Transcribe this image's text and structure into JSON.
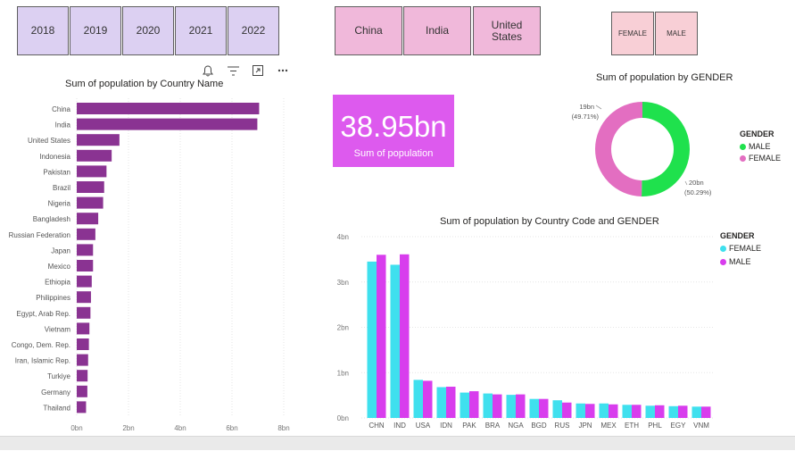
{
  "slicers": {
    "years": [
      "2018",
      "2019",
      "2020",
      "2021",
      "2022"
    ],
    "countries": [
      "China",
      "India",
      "United States"
    ],
    "genders": [
      "FEMALE",
      "MALE"
    ]
  },
  "colors": {
    "bar_purple": "#8a3392",
    "male_green": "#1fe14d",
    "female_pink": "#e36ec1",
    "female_cyan": "#3fe0ee",
    "male_magenta": "#d83ded",
    "card_bg": "#dd5aee"
  },
  "header_icons": [
    "bell-icon",
    "filter-icon",
    "focus-mode-icon",
    "more-options-icon"
  ],
  "card": {
    "value": "38.95bn",
    "label": "Sum of population"
  },
  "chart_data": [
    {
      "type": "bar",
      "orientation": "horizontal",
      "title": "Sum of population by Country Name",
      "categories": [
        "China",
        "India",
        "United States",
        "Indonesia",
        "Pakistan",
        "Brazil",
        "Nigeria",
        "Bangladesh",
        "Russian Federation",
        "Japan",
        "Mexico",
        "Ethiopia",
        "Philippines",
        "Egypt, Arab Rep.",
        "Vietnam",
        "Congo, Dem. Rep.",
        "Iran, Islamic Rep.",
        "Turkiye",
        "Germany",
        "Thailand"
      ],
      "values": [
        7.05,
        6.98,
        1.65,
        1.35,
        1.15,
        1.06,
        1.02,
        0.83,
        0.72,
        0.63,
        0.63,
        0.58,
        0.55,
        0.53,
        0.49,
        0.47,
        0.44,
        0.42,
        0.41,
        0.36
      ],
      "xticks": [
        "0bn",
        "2bn",
        "4bn",
        "6bn",
        "8bn"
      ],
      "xlim": [
        0,
        8
      ]
    },
    {
      "type": "pie",
      "donut": true,
      "title": "Sum of population by GENDER",
      "legend_title": "GENDER",
      "legend": [
        "MALE",
        "FEMALE"
      ],
      "slices": [
        {
          "name": "MALE",
          "value": 20,
          "percent": 50.29,
          "label_value": "20bn",
          "label_pct": "(50.29%)"
        },
        {
          "name": "FEMALE",
          "value": 19,
          "percent": 49.71,
          "label_value": "19bn",
          "label_pct": "(49.71%)"
        }
      ]
    },
    {
      "type": "bar",
      "title": "Sum of population by Country Code and GENDER",
      "legend_title": "GENDER",
      "legend_position": "top-right",
      "categories": [
        "CHN",
        "IND",
        "USA",
        "IDN",
        "PAK",
        "BRA",
        "NGA",
        "BGD",
        "RUS",
        "JPN",
        "MEX",
        "ETH",
        "PHL",
        "EGY",
        "VNM"
      ],
      "series": [
        {
          "name": "FEMALE",
          "values": [
            3.45,
            3.38,
            0.84,
            0.68,
            0.56,
            0.54,
            0.51,
            0.42,
            0.39,
            0.32,
            0.32,
            0.29,
            0.27,
            0.26,
            0.25
          ]
        },
        {
          "name": "MALE",
          "values": [
            3.6,
            3.61,
            0.82,
            0.69,
            0.59,
            0.52,
            0.52,
            0.42,
            0.34,
            0.31,
            0.3,
            0.29,
            0.28,
            0.27,
            0.25
          ]
        }
      ],
      "yticks": [
        "0bn",
        "1bn",
        "2bn",
        "3bn",
        "4bn"
      ],
      "ylim": [
        0,
        4
      ]
    }
  ]
}
